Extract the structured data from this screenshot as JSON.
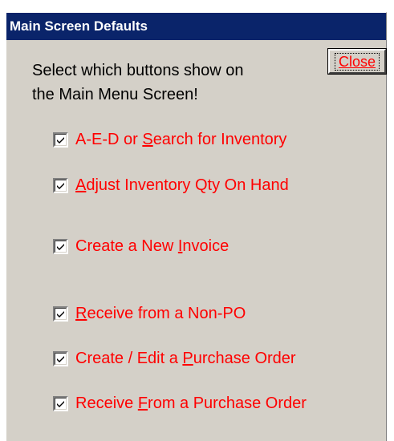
{
  "window": {
    "title": "Main Screen Defaults"
  },
  "intro": {
    "line1": "Select which buttons show on",
    "line2": "the Main Menu Screen!"
  },
  "close_button": {
    "label": "Close"
  },
  "options": [
    {
      "pre": "A-E-D or ",
      "key": "S",
      "post": "earch for Inventory",
      "checked": true
    },
    {
      "pre": "",
      "key": "A",
      "post": "djust Inventory Qty On Hand",
      "checked": true
    },
    {
      "pre": "Create a New ",
      "key": "I",
      "post": "nvoice",
      "checked": true
    },
    {
      "pre": "",
      "key": "R",
      "post": "eceive from a Non-PO",
      "checked": true
    },
    {
      "pre": "Create / Edit a ",
      "key": "P",
      "post": "urchase Order",
      "checked": true
    },
    {
      "pre": "Receive ",
      "key": "F",
      "post": "rom a Purchase Order",
      "checked": true
    }
  ],
  "colors": {
    "window_bg": "#d4d0c8",
    "titlebar_bg": "#0a246a",
    "label_red": "#ff0000"
  }
}
